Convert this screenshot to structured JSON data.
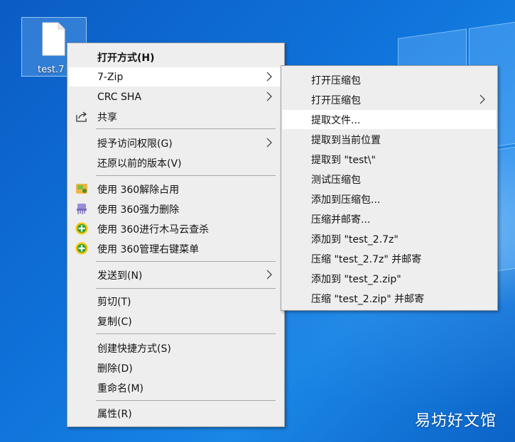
{
  "desktop": {
    "file_icon_label": "test.7"
  },
  "context_menu": {
    "items": [
      {
        "label": "打开方式(H)"
      },
      {
        "label": "7-Zip"
      },
      {
        "label": "CRC SHA"
      },
      {
        "label": "共享"
      },
      {
        "label": "授予访问权限(G)"
      },
      {
        "label": "还原以前的版本(V)"
      },
      {
        "label": "使用 360解除占用"
      },
      {
        "label": "使用 360强力删除"
      },
      {
        "label": "使用 360进行木马云查杀"
      },
      {
        "label": "使用 360管理右键菜单"
      },
      {
        "label": "发送到(N)"
      },
      {
        "label": "剪切(T)"
      },
      {
        "label": "复制(C)"
      },
      {
        "label": "创建快捷方式(S)"
      },
      {
        "label": "删除(D)"
      },
      {
        "label": "重命名(M)"
      },
      {
        "label": "属性(R)"
      }
    ]
  },
  "sevenzip_submenu": {
    "items": [
      {
        "label": "打开压缩包"
      },
      {
        "label": "打开压缩包"
      },
      {
        "label": "提取文件..."
      },
      {
        "label": "提取到当前位置"
      },
      {
        "label": "提取到 \"test\\\""
      },
      {
        "label": "测试压缩包"
      },
      {
        "label": "添加到压缩包..."
      },
      {
        "label": "压缩并邮寄..."
      },
      {
        "label": "添加到 \"test_2.7z\""
      },
      {
        "label": "压缩 \"test_2.7z\" 并邮寄"
      },
      {
        "label": "添加到 \"test_2.zip\""
      },
      {
        "label": "压缩 \"test_2.zip\" 并邮寄"
      }
    ]
  },
  "watermark": {
    "text": "易坊好文馆"
  },
  "colors": {
    "menu_background": "#eeeeee",
    "menu_hover": "#ffffff",
    "desktop_blue": "#0a62c9"
  }
}
